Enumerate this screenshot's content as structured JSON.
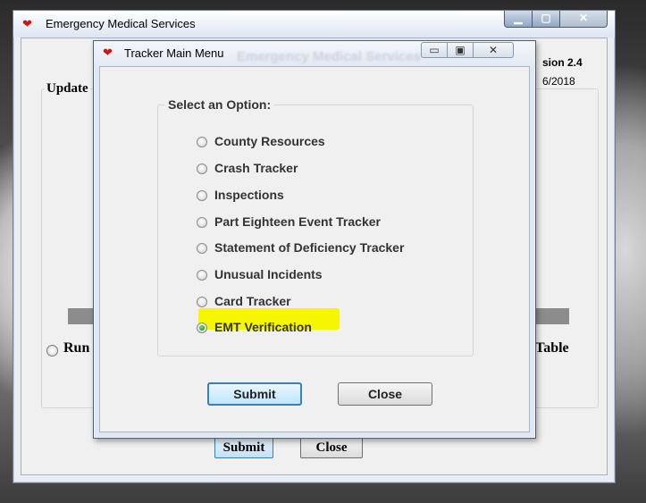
{
  "outer_window": {
    "title": "Emergency Medical Services",
    "title_icon": "heart-icon",
    "controls": {
      "minimize": "▁",
      "maximize": "▢",
      "close": "✕"
    },
    "version": "sion 2.4",
    "date": "6/2018",
    "group_title": "Update",
    "radio_left_label": "Run",
    "right_label": "Table",
    "submit_label": "Submit",
    "close_label": "Close"
  },
  "modal": {
    "title": "Tracker Main Menu",
    "title_icon": "heart-icon",
    "ghost_title": "Emergency Medical Services",
    "controls": {
      "minimize": "▭",
      "maximize": "▣",
      "close": "✕"
    },
    "group_title": "Select an Option:",
    "options": [
      {
        "label": "County Resources",
        "checked": false
      },
      {
        "label": "Crash Tracker",
        "checked": false
      },
      {
        "label": "Inspections",
        "checked": false
      },
      {
        "label": "Part Eighteen Event Tracker",
        "checked": false
      },
      {
        "label": "Statement of Deficiency Tracker",
        "checked": false
      },
      {
        "label": "Unusual Incidents",
        "checked": false
      },
      {
        "label": "Card Tracker",
        "checked": false
      },
      {
        "label": "EMT Verification",
        "checked": true
      }
    ],
    "highlight_color": "#f6f600",
    "submit_label": "Submit",
    "close_label": "Close"
  }
}
